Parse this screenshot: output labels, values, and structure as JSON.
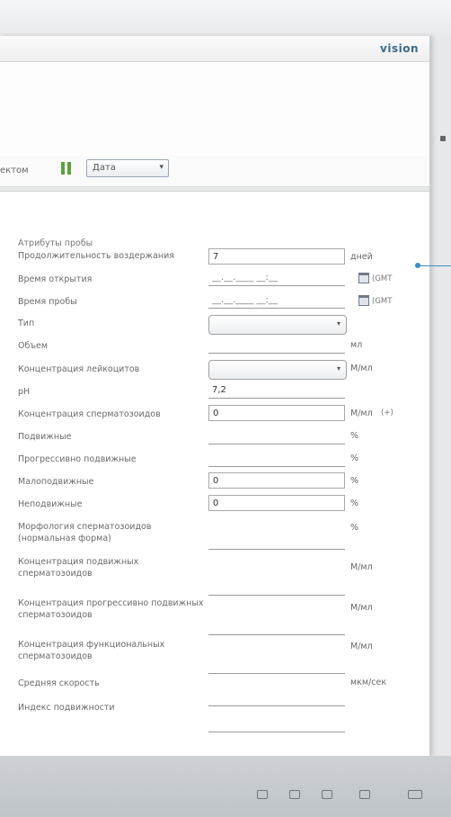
{
  "header": {
    "logo": "vision"
  },
  "toolbar": {
    "label": "ектом",
    "select": "Дата"
  },
  "form": {
    "group_title": "Атрибуты пробы",
    "rows": [
      {
        "label": "Продолжительность воздержания",
        "value": "7",
        "unit": "дней"
      },
      {
        "label": "Время открытия",
        "value": "",
        "placeholder": "__.__.____ __:__",
        "tz": "(GMT"
      },
      {
        "label": "Время пробы",
        "value": "",
        "placeholder": "__.__.____ __:__",
        "tz": "(GMT"
      },
      {
        "label": "Тип",
        "value": ""
      },
      {
        "label": "Объем",
        "value": "",
        "unit": "мл"
      },
      {
        "label": "Концентрация лейкоцитов",
        "value": "",
        "unit": "М/мл"
      },
      {
        "label": "pH",
        "value": "7,2"
      },
      {
        "label": "Концентрация сперматозоидов",
        "value": "0",
        "unit": "М/мл",
        "tz": "(+)"
      },
      {
        "label": "Подвижные",
        "value": "",
        "unit": "%"
      },
      {
        "label": "Прогрессивно подвижные",
        "value": "",
        "unit": "%"
      },
      {
        "label": "Малоподвижные",
        "value": "0",
        "unit": "%"
      },
      {
        "label": "Неподвижные",
        "value": "0",
        "unit": "%"
      },
      {
        "label": "Морфология сперматозоидов (нормальная форма)",
        "value": "",
        "unit": "%"
      },
      {
        "label": "Концентрация подвижных сперматозоидов",
        "value": "",
        "unit": "М/мл"
      },
      {
        "label": "Концентрация прогрессивно подвижных сперматозоидов",
        "value": "",
        "unit": "М/мл"
      },
      {
        "label": "Концентрация функциональных сперматозоидов",
        "value": "",
        "unit": "М/мл"
      },
      {
        "label": "Средняя скорость",
        "value": "",
        "unit": "мкм/сек"
      },
      {
        "label": "Индекс подвижности",
        "value": ""
      }
    ]
  },
  "colors": {
    "accent": "#3b8fc8",
    "pause": "#5aa33a"
  }
}
